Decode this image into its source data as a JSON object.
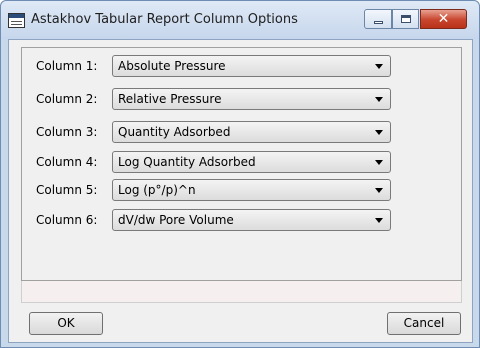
{
  "window": {
    "title": "Astakhov Tabular Report Column Options",
    "controls": [
      "minimize",
      "maximize",
      "close"
    ],
    "close_glyph": "✕"
  },
  "columns": [
    {
      "label": "Column 1:",
      "value": "Absolute Pressure"
    },
    {
      "label": "Column 2:",
      "value": "Relative Pressure"
    },
    {
      "label": "Column 3:",
      "value": "Quantity Adsorbed"
    },
    {
      "label": "Column 4:",
      "value": "Log Quantity Adsorbed"
    },
    {
      "label": "Column 5:",
      "value": "Log (p°/p)^n"
    },
    {
      "label": "Column 6:",
      "value": "dV/dw Pore Volume"
    }
  ],
  "buttons": {
    "ok": "OK",
    "cancel": "Cancel"
  },
  "colors": {
    "titlebar": "#c6d6ec",
    "close_button": "#c8452d",
    "dialog_bg": "#f0f0f0",
    "status_strip": "#f6efef"
  }
}
